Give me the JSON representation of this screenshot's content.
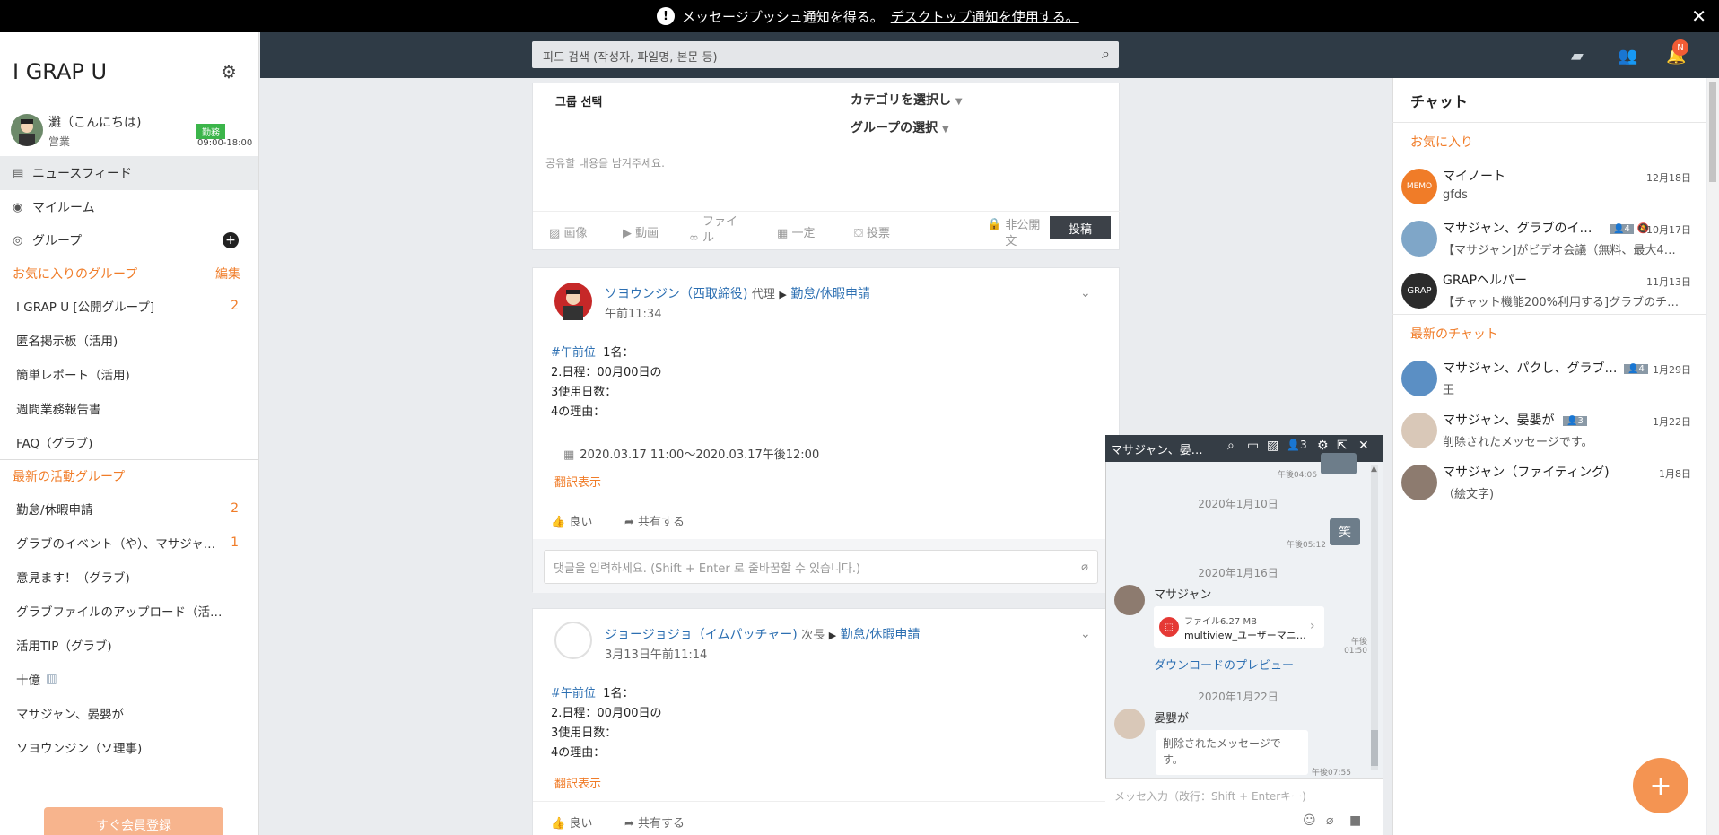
{
  "notification": {
    "icon": "exclamation-icon",
    "text": "メッセージプッシュ通知を得る。",
    "link": "デスクトップ通知を使用する。",
    "close": "✕"
  },
  "sidebar": {
    "title": "I GRAP U",
    "user": {
      "name": "灘（こんにちは)",
      "role": "営業",
      "status": "勤務",
      "hours": "09:00-18:00"
    },
    "nav": [
      {
        "label": "ニュースフィード",
        "icon": "clipboard-icon"
      },
      {
        "label": "マイルーム",
        "icon": "person-icon"
      },
      {
        "label": "グループ",
        "icon": "group-icon"
      }
    ],
    "favorites": {
      "title": "お気に入りのグループ",
      "edit": "編集",
      "items": [
        {
          "label": "I GRAP U [公開グループ]",
          "count": "2"
        },
        {
          "label": "匿名掲示板（活用)",
          "count": ""
        },
        {
          "label": "簡単レポート（活用)",
          "count": ""
        },
        {
          "label": "週間業務報告書",
          "count": ""
        },
        {
          "label": "FAQ（グラブ)",
          "count": ""
        }
      ]
    },
    "recent": {
      "title": "最新の活動グループ",
      "items": [
        {
          "label": "勤怠/休暇申請",
          "count": "2"
        },
        {
          "label": "グラブのイベント（や）、マサジャ…",
          "count": "1"
        },
        {
          "label": "意見ます！（グラブ)",
          "count": ""
        },
        {
          "label": "グラブファイルのアップロード（活…",
          "count": ""
        },
        {
          "label": "活用TIP（グラブ)",
          "count": ""
        },
        {
          "label": "十億",
          "count": ""
        },
        {
          "label": "マサジャン、晏嬰が",
          "count": ""
        },
        {
          "label": "ソヨウンジン（ソ理事)",
          "count": ""
        }
      ]
    },
    "signup": "すぐ会員登録"
  },
  "topbar": {
    "search_placeholder": "피드 검색 (작성자, 파일명, 본문 등)",
    "notif_badge": "N"
  },
  "composer": {
    "group": "그룹 선택",
    "category": "カテゴリを選択し",
    "group_select": "グループの選択",
    "placeholder": "공유할 내용을 남겨주세요.",
    "tools": [
      "画像",
      "動画",
      "ファイル",
      "一定",
      "投票"
    ],
    "private": "非公開文",
    "post": "投稿"
  },
  "posts": [
    {
      "author": "ソヨウンジン（西取締役)",
      "title": "代理",
      "group": "勤怠/休暇申請",
      "time": "午前11:34",
      "tag": "#午前位",
      "lines": [
        "1名：",
        "2.日程：00月00日の",
        "3使用日数：",
        "4の理由："
      ],
      "event": "2020.03.17 11:00～2020.03.17午後12:00",
      "translate": "翻訳表示",
      "like": "良い",
      "share": "共有する",
      "comment_placeholder": "댓글을 입력하세요. (Shift + Enter 로 줄바꿈할 수 있습니다.)"
    },
    {
      "author": "ジョージョジョ（イムパッチャー)",
      "title": "次長",
      "group": "勤怠/休暇申請",
      "time": "3月13日午前11:14",
      "tag": "#午前位",
      "lines": [
        "1名：",
        "2.日程：00月00日の",
        "3使用日数：",
        "4の理由："
      ],
      "translate": "翻訳表示",
      "like": "良い",
      "share": "共有する"
    }
  ],
  "chat": {
    "title": "チャット",
    "favorites_title": "お気に入り",
    "recent_title": "最新のチャット",
    "favorites": [
      {
        "name": "マイノート",
        "msg": "gfds",
        "date": "12月18日",
        "count": "",
        "avatar": "MEMO"
      },
      {
        "name": "マサジャン、グラブのイ…",
        "msg": "【マサジャン]がビデオ会議（無料、最大4…",
        "date": "10月17日",
        "count": "4",
        "avatar": ""
      },
      {
        "name": "GRAPヘルパー",
        "msg": "【チャット機能200%利用する]グラブのチ…",
        "date": "11月13日",
        "count": "",
        "avatar": "GRAP"
      }
    ],
    "recent": [
      {
        "name": "マサジャン、パクし、グラブ…",
        "msg": "王",
        "date": "1月29日",
        "count": "4"
      },
      {
        "name": "マサジャン、晏嬰が",
        "msg": "削除されたメッセージです。",
        "date": "1月22日",
        "count": "3"
      },
      {
        "name": "マサジャン（ファイティング)",
        "msg": "（絵文字)",
        "date": "1月8日",
        "count": ""
      }
    ]
  },
  "mini_chat": {
    "title": "マサジャン、晏…",
    "members": "3",
    "msgs": [
      {
        "time": "午後04:06"
      },
      {
        "date": "2020年1月10日",
        "bubble": "笑",
        "time": "午後05:12"
      },
      {
        "date": "2020年1月16日",
        "sender": "マサジャン",
        "file_label": "ファイル6.27 MB",
        "file_name": "multiview_ユーザーマニ…",
        "time": "午後 01:50",
        "preview": "ダウンロードのプレビュー"
      },
      {
        "date": "2020年1月22日",
        "sender": "晏嬰が",
        "text": "削除されたメッセージです。",
        "time": "午後07:55"
      }
    ],
    "input_placeholder": "メッセ入力（改行：Shift + Enterキー)"
  },
  "colors": {
    "accent": "#f07c28",
    "link": "#2c6fb2",
    "topbar": "#2f3b46",
    "status": "#3bb54a"
  }
}
